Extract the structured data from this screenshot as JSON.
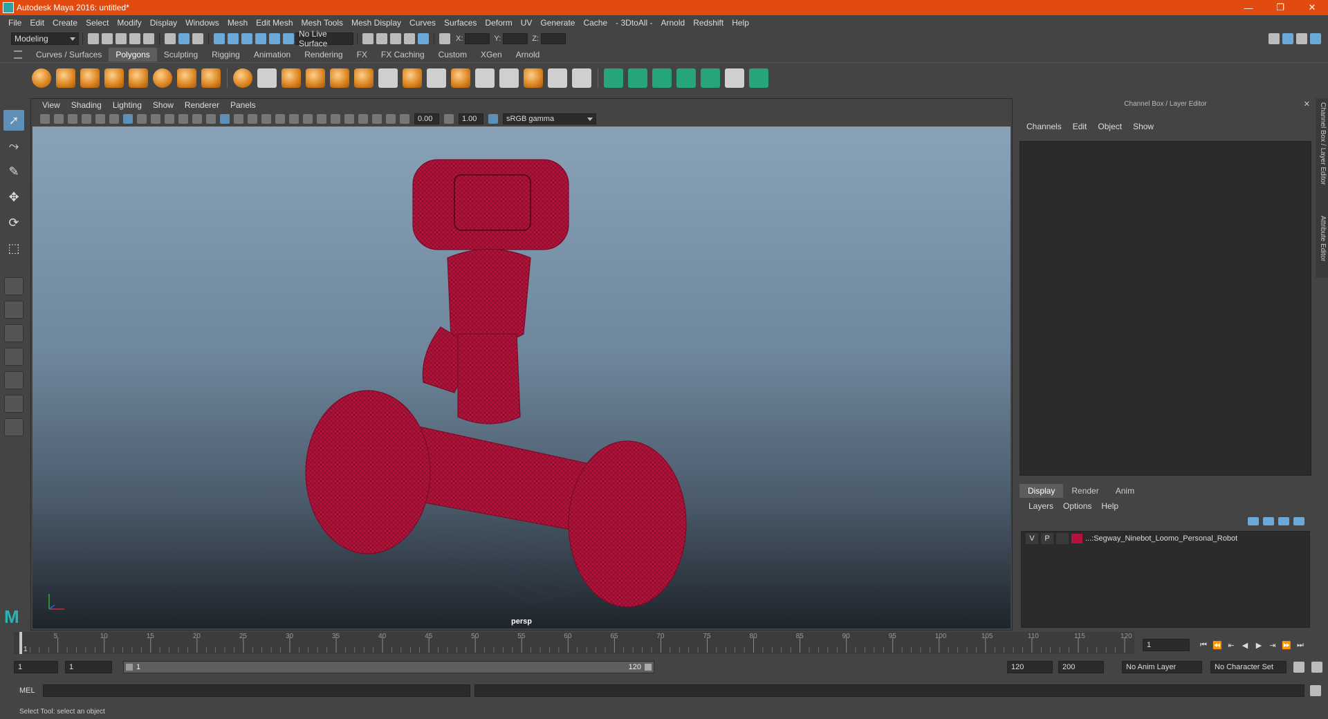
{
  "window": {
    "title": "Autodesk Maya 2016: untitled*",
    "controls": [
      "—",
      "❐",
      "✕"
    ]
  },
  "menus": [
    "File",
    "Edit",
    "Create",
    "Select",
    "Modify",
    "Display",
    "Windows",
    "Mesh",
    "Edit Mesh",
    "Mesh Tools",
    "Mesh Display",
    "Curves",
    "Surfaces",
    "Deform",
    "UV",
    "Generate",
    "Cache",
    "- 3DtoAll -",
    "Arnold",
    "Redshift",
    "Help"
  ],
  "status_line": {
    "mode": "Modeling",
    "live_surface": "No Live Surface",
    "x_label": "X:",
    "y_label": "Y:",
    "z_label": "Z:"
  },
  "shelf": {
    "tabs": [
      "Curves / Surfaces",
      "Polygons",
      "Sculpting",
      "Rigging",
      "Animation",
      "Rendering",
      "FX",
      "FX Caching",
      "Custom",
      "XGen",
      "Arnold"
    ],
    "active_tab": "Polygons"
  },
  "viewport": {
    "menus": [
      "View",
      "Shading",
      "Lighting",
      "Show",
      "Renderer",
      "Panels"
    ],
    "exposure": "0.00",
    "gamma": "1.00",
    "color_space": "sRGB gamma",
    "camera": "persp",
    "wire_color": "#b3123a"
  },
  "channel_box": {
    "title": "Channel Box / Layer Editor",
    "menus": [
      "Channels",
      "Edit",
      "Object",
      "Show"
    ],
    "layer_tabs": [
      "Display",
      "Render",
      "Anim"
    ],
    "active_layer_tab": "Display",
    "layer_menus": [
      "Layers",
      "Options",
      "Help"
    ],
    "layers": [
      {
        "v": "V",
        "p": "P",
        "name": "...:Segway_Ninebot_Loomo_Personal_Robot",
        "color": "#b3123a"
      }
    ]
  },
  "side_tabs": [
    "Channel Box / Layer Editor",
    "Attribute Editor"
  ],
  "timeline": {
    "start": 1,
    "end": 120,
    "major_step": 5,
    "tick_labels": [
      5,
      10,
      15,
      20,
      25,
      30,
      35,
      40,
      45,
      50,
      55,
      60,
      65,
      70,
      75,
      80,
      85,
      90,
      95,
      100,
      105,
      110,
      115,
      120
    ],
    "current_frame_label": "1",
    "current_frame_field": "1"
  },
  "range": {
    "start_field": "1",
    "playback_start": "1",
    "range_lo": "1",
    "range_hi": "120",
    "playback_end": "120",
    "end_field": "200",
    "anim_layer": "No Anim Layer",
    "character_set": "No Character Set"
  },
  "command_line": {
    "label": "MEL"
  },
  "help_line": "Select Tool: select an object"
}
